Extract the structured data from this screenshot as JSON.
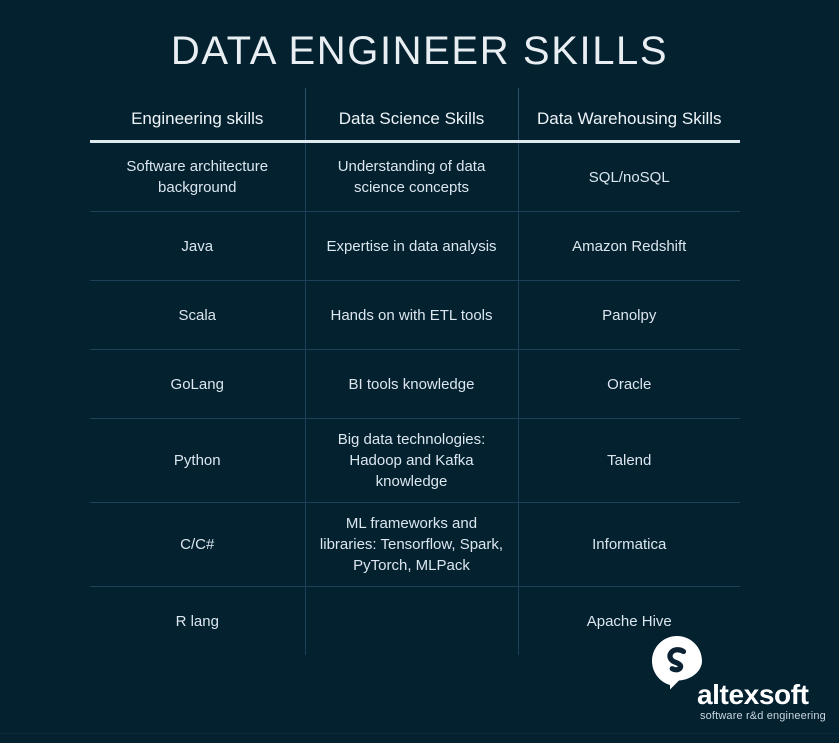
{
  "page": {
    "title": "DATA ENGINEER SKILLS",
    "background_color": "#04212f",
    "title_color": "#e8eef2",
    "header_rule_color": "#dfe9f0",
    "grid_line_color": "#1d4159"
  },
  "table": {
    "columns": [
      "Engineering skills",
      "Data Science Skills",
      "Data Warehousing Skills"
    ],
    "rows": [
      [
        "Software architecture background",
        "Understanding of data science concepts",
        "SQL/noSQL"
      ],
      [
        "Java",
        "Expertise in data analysis",
        "Amazon Redshift"
      ],
      [
        "Scala",
        "Hands on with ETL tools",
        "Panolpy"
      ],
      [
        "GoLang",
        "BI tools knowledge",
        "Oracle"
      ],
      [
        "Python",
        "Big data technologies: Hadoop and Kafka knowledge",
        "Talend"
      ],
      [
        "C/C#",
        "ML frameworks and libraries: Tensorflow, Spark, PyTorch, MLPack",
        "Informatica"
      ],
      [
        "R lang",
        "",
        "Apache Hive"
      ]
    ]
  },
  "logo": {
    "mark": "altexsoft-logo-icon",
    "wordmark": "altexsoft",
    "tagline": "software r&d engineering",
    "color": "#ffffff"
  }
}
